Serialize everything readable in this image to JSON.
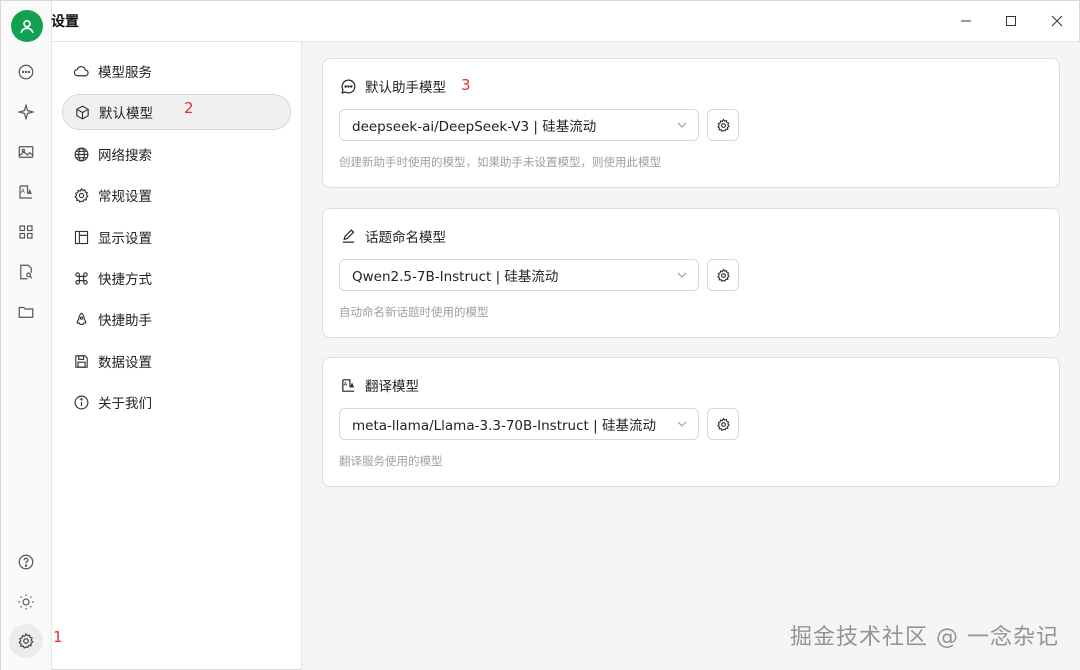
{
  "window": {
    "title": "设置",
    "controls": [
      "minimize-icon",
      "maximize-icon",
      "close-icon"
    ]
  },
  "rail": {
    "icons": [
      "chat-icon",
      "sparkle-icon",
      "image-icon",
      "translate-icon",
      "apps-icon",
      "file-search-icon",
      "folder-icon",
      "help-icon",
      "sun-icon",
      "gear-icon"
    ]
  },
  "nav": {
    "items": [
      {
        "label": "模型服务",
        "icon": "cloud-icon"
      },
      {
        "label": "默认模型",
        "icon": "cube-icon",
        "active": true
      },
      {
        "label": "网络搜索",
        "icon": "globe-icon"
      },
      {
        "label": "常规设置",
        "icon": "gear-icon"
      },
      {
        "label": "显示设置",
        "icon": "layout-icon"
      },
      {
        "label": "快捷方式",
        "icon": "command-icon"
      },
      {
        "label": "快捷助手",
        "icon": "rocket-icon"
      },
      {
        "label": "数据设置",
        "icon": "save-icon"
      },
      {
        "label": "关于我们",
        "icon": "info-icon"
      }
    ]
  },
  "cards": [
    {
      "title": "默认助手模型",
      "icon": "message-icon",
      "selected": "deepseek-ai/DeepSeek-V3 | 硅基流动",
      "description": "创建新助手时使用的模型，如果助手未设置模型，则使用此模型"
    },
    {
      "title": "话题命名模型",
      "icon": "pencil-icon",
      "selected": "Qwen2.5-7B-Instruct | 硅基流动",
      "description": "自动命名新话题时使用的模型"
    },
    {
      "title": "翻译模型",
      "icon": "translate-icon",
      "selected": "meta-llama/Llama-3.3-70B-Instruct | 硅基流动",
      "description": "翻译服务使用的模型"
    }
  ],
  "annotations": {
    "a1": "1",
    "a2": "2",
    "a3": "3"
  },
  "watermark": "掘金技术社区 @ 一念杂记",
  "colors": {
    "accent": "#12a150",
    "annotation": "#e03030"
  }
}
